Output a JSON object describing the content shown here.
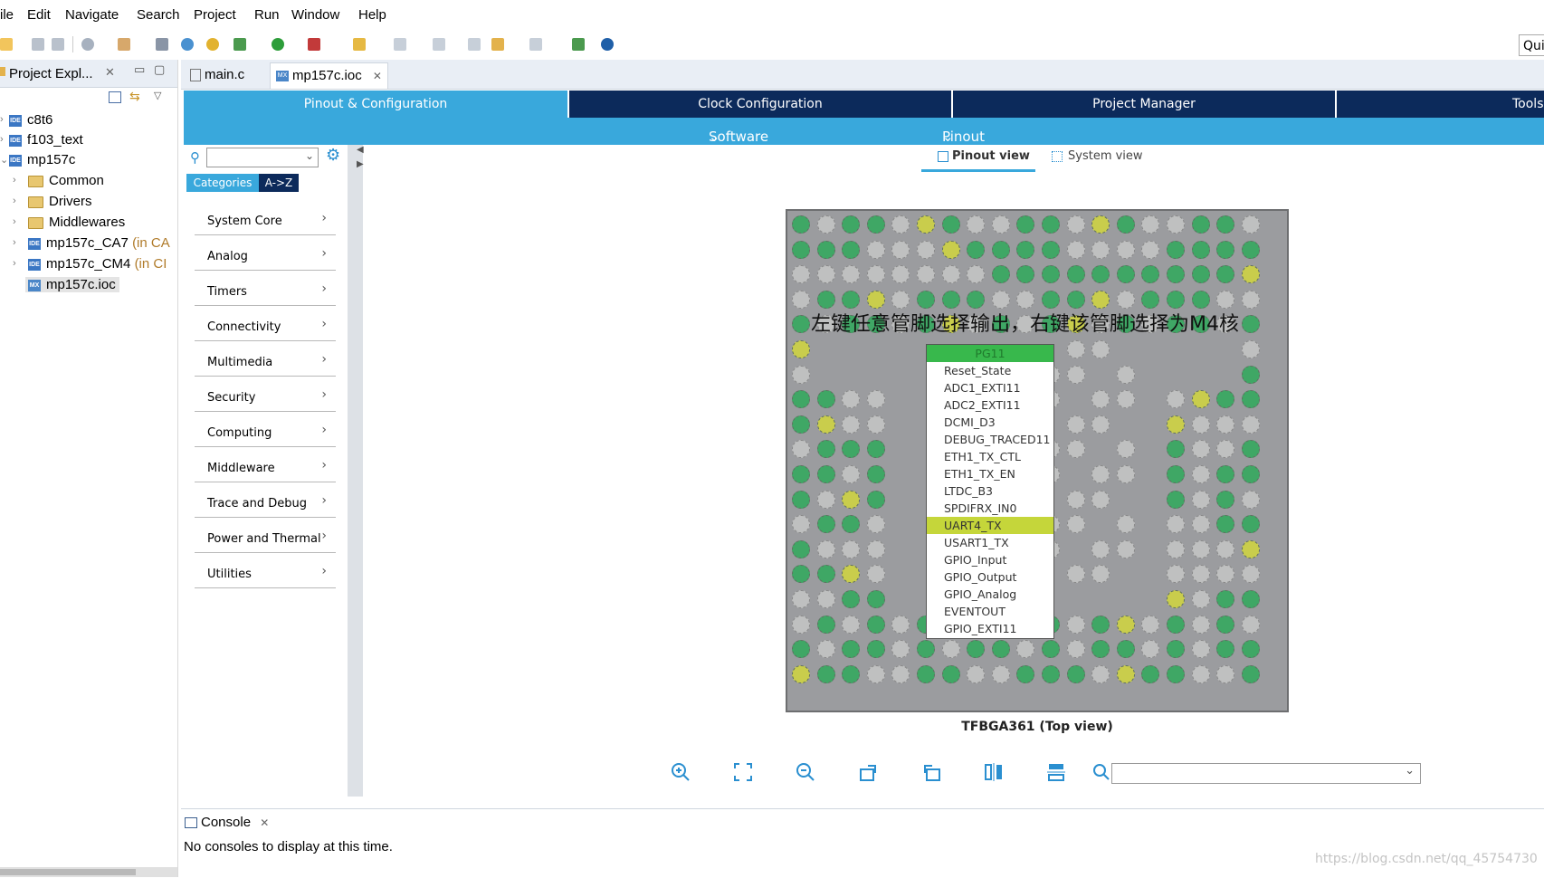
{
  "menu": [
    "ile",
    "Edit",
    "Navigate",
    "Search",
    "Project",
    "Run",
    "Window",
    "Help"
  ],
  "toolbar": {
    "quick_access": "Qui"
  },
  "project_explorer": {
    "title": "Project Expl...",
    "items": [
      {
        "label": "c8t6",
        "suffix": "",
        "icon": "ide-icon"
      },
      {
        "label": "f103_text",
        "suffix": "",
        "icon": "ide-icon"
      },
      {
        "label": "mp157c",
        "suffix": "",
        "icon": "ide-icon"
      },
      {
        "label": "Common",
        "suffix": "",
        "icon": "folder-icon"
      },
      {
        "label": "Drivers",
        "suffix": "",
        "icon": "folder-icon"
      },
      {
        "label": "Middlewares",
        "suffix": "",
        "icon": "folder-icon"
      },
      {
        "label": "mp157c_CA7",
        "suffix": "(in CA",
        "icon": "ide-icon"
      },
      {
        "label": "mp157c_CM4",
        "suffix": "(in CI",
        "icon": "ide-icon"
      },
      {
        "label": "mp157c.ioc",
        "suffix": "",
        "icon": "mx-icon"
      }
    ]
  },
  "editor_tabs": [
    {
      "label": "main.c",
      "active": false
    },
    {
      "label": "mp157c.ioc",
      "active": true
    }
  ],
  "cube_tabs": [
    {
      "label": "Pinout & Configuration",
      "active": true
    },
    {
      "label": "Clock Configuration",
      "active": false
    },
    {
      "label": "Project Manager",
      "active": false
    },
    {
      "label": "Tools",
      "active": false
    }
  ],
  "subbar": {
    "software_packs": "Software Packs",
    "pinout": "Pinout"
  },
  "views": {
    "pinout": "Pinout view",
    "system": "System view"
  },
  "categories": {
    "tab_categories": "Categories",
    "tab_az": "A->Z",
    "items": [
      "System Core",
      "Analog",
      "Timers",
      "Connectivity",
      "Multimedia",
      "Security",
      "Computing",
      "Middleware",
      "Trace and Debug",
      "Power and Thermal",
      "Utilities"
    ]
  },
  "annotation": "左键任意管脚选择输出，右键该管脚选择为M4核",
  "pin_popup": {
    "pin": "PG11",
    "options": [
      "Reset_State",
      "ADC1_EXTI11",
      "ADC2_EXTI11",
      "DCMI_D3",
      "DEBUG_TRACED11",
      "ETH1_TX_CTL",
      "ETH1_TX_EN",
      "LTDC_B3",
      "SPDIFRX_IN0",
      "UART4_TX",
      "USART1_TX",
      "GPIO_Input",
      "GPIO_Output",
      "GPIO_Analog",
      "EVENTOUT",
      "GPIO_EXTI11"
    ],
    "selected": "UART4_TX"
  },
  "chip_label": "TFBGA361 (Top view)",
  "console": {
    "title": "Console",
    "message": "No consoles to display at this time."
  },
  "watermark": "https://blog.csdn.net/qq_45754730",
  "colors": {
    "accent_blue": "#39a8dc",
    "dark_navy": "#0c2a5b",
    "pin_green": "#3fa765",
    "pin_yellow": "#c9cd4c",
    "pin_gray": "#bfc0c0",
    "popup_header": "#38b84c",
    "popup_selected": "#c5d63a"
  }
}
